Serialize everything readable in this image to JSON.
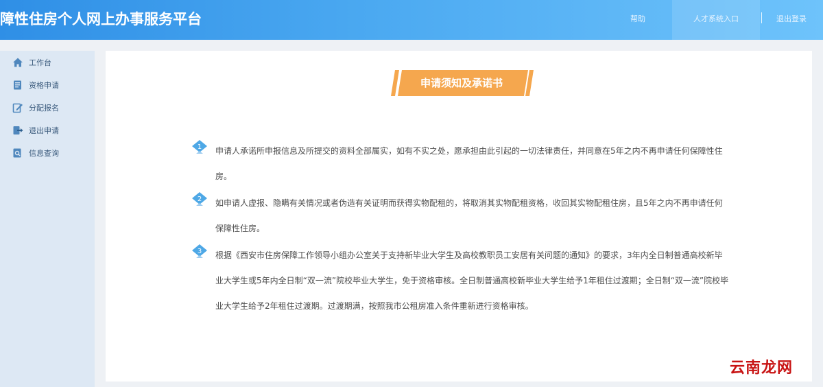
{
  "header": {
    "title": "障性住房个人网上办事服务平台",
    "nav": {
      "help": "帮助",
      "talent": "人才系统入口",
      "logout": "退出登录"
    }
  },
  "sidebar": {
    "items": [
      {
        "label": "工作台",
        "icon": "home-icon"
      },
      {
        "label": "资格申请",
        "icon": "form-icon"
      },
      {
        "label": "分配报名",
        "icon": "edit-icon"
      },
      {
        "label": "退出申请",
        "icon": "exit-icon"
      },
      {
        "label": "信息查询",
        "icon": "search-doc-icon"
      }
    ]
  },
  "main": {
    "title": "申请须知及承诺书",
    "items": [
      {
        "num": "1",
        "text": "申请人承诺所申报信息及所提交的资料全部属实，如有不实之处，愿承担由此引起的一切法律责任，并同意在5年之内不再申请任何保障性住房。"
      },
      {
        "num": "2",
        "text": "如申请人虚报、隐瞒有关情况或者伪造有关证明而获得实物配租的，将取消其实物配租资格，收回其实物配租住房，且5年之内不再申请任何保障性住房。"
      },
      {
        "num": "3",
        "text": "根据《西安市住房保障工作领导小组办公室关于支持新毕业大学生及高校教职员工安居有关问题的通知》的要求，3年内全日制普通高校新毕业大学生或5年内全日制“双一流”院校毕业大学生，免于资格审核。全日制普通高校新毕业大学生给予1年租住过渡期；全日制“双一流”院校毕业大学生给予2年租住过渡期。过渡期满，按照我市公租房准入条件重新进行资格审核。"
      }
    ]
  },
  "watermark": "云南龙网",
  "colors": {
    "header_start": "#2f8fe6",
    "accent_orange": "#f5a74e",
    "badge_blue": "#4ea8e6"
  }
}
